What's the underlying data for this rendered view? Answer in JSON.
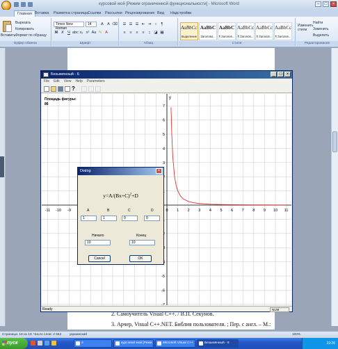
{
  "word": {
    "title": "курсовой мой [Режим ограниченной функциональности] - Microsoft Word",
    "tabs": [
      "Главная",
      "Вставка",
      "Разметка страницы",
      "Ссылки",
      "Рассылки",
      "Рецензирование",
      "Вид",
      "Надстройки"
    ],
    "clipboard": {
      "paste": "Вставить",
      "cut": "Вырезать",
      "copy": "Копировать",
      "format": "Формат по образцу",
      "group": "Буфер обмена"
    },
    "font": {
      "name": "Times New Roman",
      "size": "14",
      "group": "Шрифт"
    },
    "paragraph": {
      "group": "Абзац"
    },
    "styles": {
      "group": "Стили",
      "items": [
        {
          "sample": "AaBbCcI",
          "name": "Выделение"
        },
        {
          "sample": "AaBbC",
          "name": "Заголово..."
        },
        {
          "sample": "AaBbC",
          "name": "¶ Заголов..."
        },
        {
          "sample": "AaBbCcI",
          "name": "¶ Заголов..."
        },
        {
          "sample": "AaBbCcI",
          "name": "¶ Заголов..."
        },
        {
          "sample": "AaBbCcI",
          "name": "¶ Заголов..."
        }
      ],
      "change": "Изменить стили"
    },
    "editing": {
      "find": "Найти",
      "replace": "Заменить",
      "select": "Выделить",
      "group": "Редактирование"
    },
    "doc_lines": [
      "2. Самоучитель Visual C++. / В.П. Секунов.",
      "3. Арчер, Visual C++.NET. Библия пользователя. ; Пер. с англ. – М.:"
    ],
    "status": {
      "page": "Страница: 18 из 19",
      "words": "Число слов: 2 552",
      "lang": "украинский",
      "zoom": "100%"
    }
  },
  "app": {
    "title": "Безымянный - 6",
    "menu": [
      "File",
      "Edit",
      "View",
      "Help",
      "Parameters"
    ],
    "area_label": "Площадь фигуры:",
    "area_value": "86",
    "status": "Ready",
    "num": "NUM"
  },
  "dialog": {
    "title": "Dialog",
    "formula_prefix": "y=A/(Bx+C)",
    "formula_exp": "2",
    "formula_suffix": "+D",
    "params": [
      {
        "label": "A",
        "value": "1"
      },
      {
        "label": "B",
        "value": "1"
      },
      {
        "label": "C",
        "value": "0"
      },
      {
        "label": "D",
        "value": "0"
      }
    ],
    "start_label": "Начало",
    "start_value": "10",
    "end_label": "Конец",
    "end_value": "10",
    "cancel": "Cancel",
    "ok": "OK"
  },
  "chart_data": {
    "type": "line",
    "title": "",
    "xlabel": "",
    "ylabel": "y",
    "xlim": [
      -11.5,
      11.5
    ],
    "ylim": [
      -7.5,
      7.5
    ],
    "x_ticks": [
      -11,
      -10,
      -9,
      -8,
      -7,
      -6,
      -5,
      -4,
      -3,
      -2,
      -1,
      0,
      1,
      2,
      3,
      4,
      5,
      6,
      7,
      8,
      9,
      10,
      11
    ],
    "y_ticks": [
      -7,
      -6,
      -5,
      -4,
      -3,
      -2,
      -1,
      1,
      2,
      3,
      4,
      5,
      6,
      7
    ],
    "grid": true,
    "series": [
      {
        "color": "#e03030",
        "x": [
          0.38,
          0.45,
          0.55,
          0.7,
          0.85,
          1,
          1.25,
          1.5,
          2,
          2.5,
          3,
          4,
          5,
          6,
          7,
          8,
          9,
          10,
          11
        ],
        "y": [
          6.9,
          4.94,
          3.31,
          2.04,
          1.38,
          1.0,
          0.64,
          0.44,
          0.25,
          0.16,
          0.11,
          0.06,
          0.04,
          0.03,
          0.02,
          0.016,
          0.012,
          0.01,
          0.008
        ]
      }
    ]
  },
  "taskbar": {
    "start": "пуск",
    "buttons": [
      "3",
      "курсовой мой [Режи...",
      "Microsoft Visual C++",
      "Безымянный - 6"
    ],
    "clock": "19:26"
  },
  "colors": {
    "curve": "#e03030",
    "grid": "#c8c8c8",
    "title_bar": "#0a246a",
    "taskbar": "#2458c8"
  }
}
